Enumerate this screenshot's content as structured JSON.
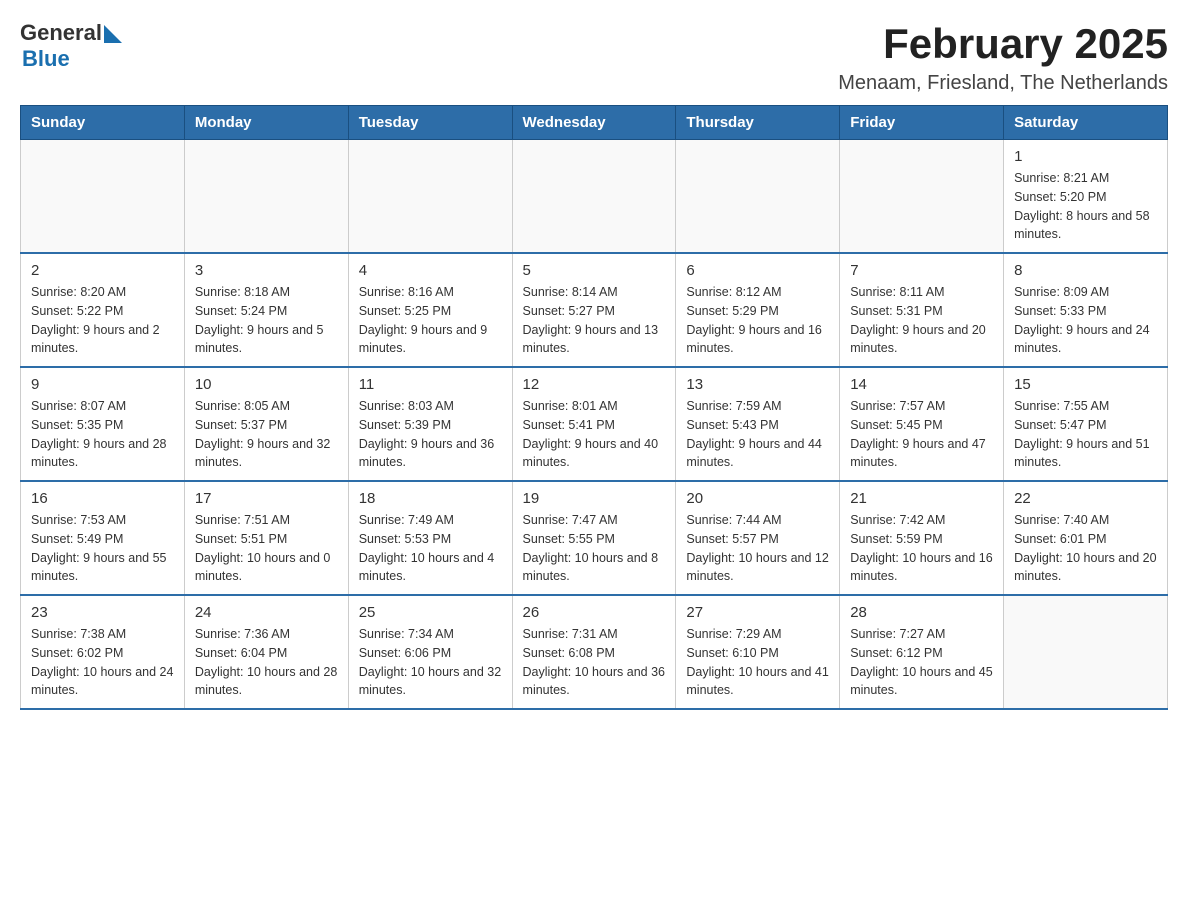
{
  "logo": {
    "general": "General",
    "blue": "Blue"
  },
  "title": "February 2025",
  "subtitle": "Menaam, Friesland, The Netherlands",
  "weekdays": [
    "Sunday",
    "Monday",
    "Tuesday",
    "Wednesday",
    "Thursday",
    "Friday",
    "Saturday"
  ],
  "weeks": [
    [
      {
        "day": "",
        "sunrise": "",
        "sunset": "",
        "daylight": ""
      },
      {
        "day": "",
        "sunrise": "",
        "sunset": "",
        "daylight": ""
      },
      {
        "day": "",
        "sunrise": "",
        "sunset": "",
        "daylight": ""
      },
      {
        "day": "",
        "sunrise": "",
        "sunset": "",
        "daylight": ""
      },
      {
        "day": "",
        "sunrise": "",
        "sunset": "",
        "daylight": ""
      },
      {
        "day": "",
        "sunrise": "",
        "sunset": "",
        "daylight": ""
      },
      {
        "day": "1",
        "sunrise": "Sunrise: 8:21 AM",
        "sunset": "Sunset: 5:20 PM",
        "daylight": "Daylight: 8 hours and 58 minutes."
      }
    ],
    [
      {
        "day": "2",
        "sunrise": "Sunrise: 8:20 AM",
        "sunset": "Sunset: 5:22 PM",
        "daylight": "Daylight: 9 hours and 2 minutes."
      },
      {
        "day": "3",
        "sunrise": "Sunrise: 8:18 AM",
        "sunset": "Sunset: 5:24 PM",
        "daylight": "Daylight: 9 hours and 5 minutes."
      },
      {
        "day": "4",
        "sunrise": "Sunrise: 8:16 AM",
        "sunset": "Sunset: 5:25 PM",
        "daylight": "Daylight: 9 hours and 9 minutes."
      },
      {
        "day": "5",
        "sunrise": "Sunrise: 8:14 AM",
        "sunset": "Sunset: 5:27 PM",
        "daylight": "Daylight: 9 hours and 13 minutes."
      },
      {
        "day": "6",
        "sunrise": "Sunrise: 8:12 AM",
        "sunset": "Sunset: 5:29 PM",
        "daylight": "Daylight: 9 hours and 16 minutes."
      },
      {
        "day": "7",
        "sunrise": "Sunrise: 8:11 AM",
        "sunset": "Sunset: 5:31 PM",
        "daylight": "Daylight: 9 hours and 20 minutes."
      },
      {
        "day": "8",
        "sunrise": "Sunrise: 8:09 AM",
        "sunset": "Sunset: 5:33 PM",
        "daylight": "Daylight: 9 hours and 24 minutes."
      }
    ],
    [
      {
        "day": "9",
        "sunrise": "Sunrise: 8:07 AM",
        "sunset": "Sunset: 5:35 PM",
        "daylight": "Daylight: 9 hours and 28 minutes."
      },
      {
        "day": "10",
        "sunrise": "Sunrise: 8:05 AM",
        "sunset": "Sunset: 5:37 PM",
        "daylight": "Daylight: 9 hours and 32 minutes."
      },
      {
        "day": "11",
        "sunrise": "Sunrise: 8:03 AM",
        "sunset": "Sunset: 5:39 PM",
        "daylight": "Daylight: 9 hours and 36 minutes."
      },
      {
        "day": "12",
        "sunrise": "Sunrise: 8:01 AM",
        "sunset": "Sunset: 5:41 PM",
        "daylight": "Daylight: 9 hours and 40 minutes."
      },
      {
        "day": "13",
        "sunrise": "Sunrise: 7:59 AM",
        "sunset": "Sunset: 5:43 PM",
        "daylight": "Daylight: 9 hours and 44 minutes."
      },
      {
        "day": "14",
        "sunrise": "Sunrise: 7:57 AM",
        "sunset": "Sunset: 5:45 PM",
        "daylight": "Daylight: 9 hours and 47 minutes."
      },
      {
        "day": "15",
        "sunrise": "Sunrise: 7:55 AM",
        "sunset": "Sunset: 5:47 PM",
        "daylight": "Daylight: 9 hours and 51 minutes."
      }
    ],
    [
      {
        "day": "16",
        "sunrise": "Sunrise: 7:53 AM",
        "sunset": "Sunset: 5:49 PM",
        "daylight": "Daylight: 9 hours and 55 minutes."
      },
      {
        "day": "17",
        "sunrise": "Sunrise: 7:51 AM",
        "sunset": "Sunset: 5:51 PM",
        "daylight": "Daylight: 10 hours and 0 minutes."
      },
      {
        "day": "18",
        "sunrise": "Sunrise: 7:49 AM",
        "sunset": "Sunset: 5:53 PM",
        "daylight": "Daylight: 10 hours and 4 minutes."
      },
      {
        "day": "19",
        "sunrise": "Sunrise: 7:47 AM",
        "sunset": "Sunset: 5:55 PM",
        "daylight": "Daylight: 10 hours and 8 minutes."
      },
      {
        "day": "20",
        "sunrise": "Sunrise: 7:44 AM",
        "sunset": "Sunset: 5:57 PM",
        "daylight": "Daylight: 10 hours and 12 minutes."
      },
      {
        "day": "21",
        "sunrise": "Sunrise: 7:42 AM",
        "sunset": "Sunset: 5:59 PM",
        "daylight": "Daylight: 10 hours and 16 minutes."
      },
      {
        "day": "22",
        "sunrise": "Sunrise: 7:40 AM",
        "sunset": "Sunset: 6:01 PM",
        "daylight": "Daylight: 10 hours and 20 minutes."
      }
    ],
    [
      {
        "day": "23",
        "sunrise": "Sunrise: 7:38 AM",
        "sunset": "Sunset: 6:02 PM",
        "daylight": "Daylight: 10 hours and 24 minutes."
      },
      {
        "day": "24",
        "sunrise": "Sunrise: 7:36 AM",
        "sunset": "Sunset: 6:04 PM",
        "daylight": "Daylight: 10 hours and 28 minutes."
      },
      {
        "day": "25",
        "sunrise": "Sunrise: 7:34 AM",
        "sunset": "Sunset: 6:06 PM",
        "daylight": "Daylight: 10 hours and 32 minutes."
      },
      {
        "day": "26",
        "sunrise": "Sunrise: 7:31 AM",
        "sunset": "Sunset: 6:08 PM",
        "daylight": "Daylight: 10 hours and 36 minutes."
      },
      {
        "day": "27",
        "sunrise": "Sunrise: 7:29 AM",
        "sunset": "Sunset: 6:10 PM",
        "daylight": "Daylight: 10 hours and 41 minutes."
      },
      {
        "day": "28",
        "sunrise": "Sunrise: 7:27 AM",
        "sunset": "Sunset: 6:12 PM",
        "daylight": "Daylight: 10 hours and 45 minutes."
      },
      {
        "day": "",
        "sunrise": "",
        "sunset": "",
        "daylight": ""
      }
    ]
  ]
}
